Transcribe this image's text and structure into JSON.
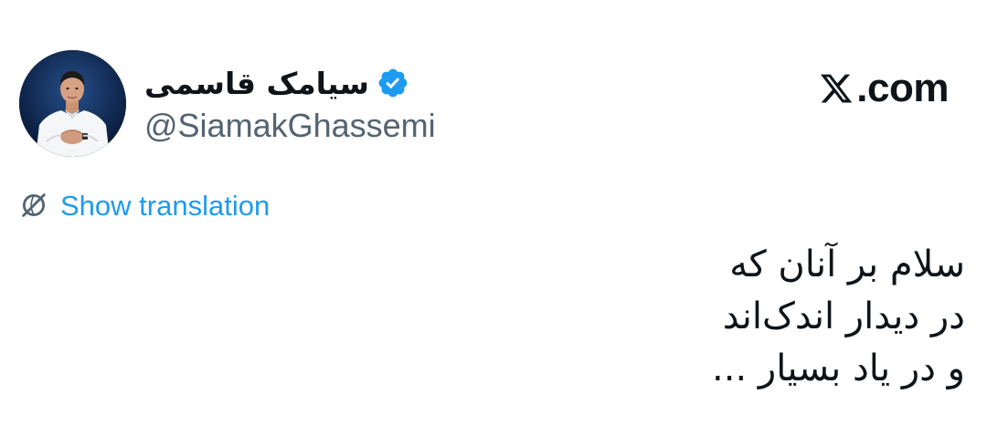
{
  "author": {
    "display_name": "سیامک قاسمی",
    "handle": "@SiamakGhassemi",
    "verified_icon": "verified-badge-icon",
    "verified_color": "#1d9bf0"
  },
  "brand": {
    "logo_icon": "x-logo-icon",
    "label": ".com"
  },
  "translate": {
    "icon": "globe-icon",
    "label": "Show translation",
    "color": "#1d9bf0"
  },
  "tweet": {
    "lines": [
      "سلام بر آنان که",
      "در دیدار اندک‌اند",
      "و در یاد بسیار ..."
    ]
  }
}
